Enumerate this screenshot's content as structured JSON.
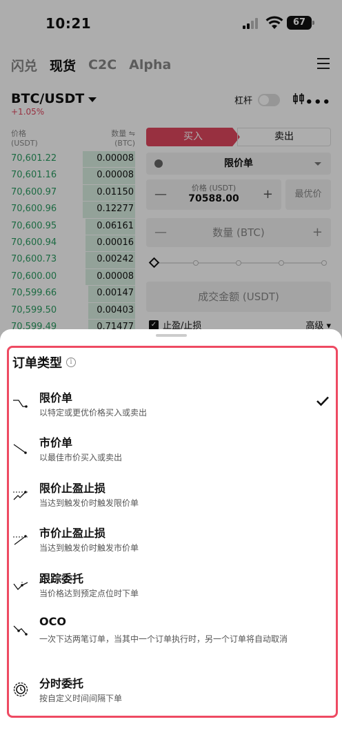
{
  "status": {
    "time": "10:21",
    "battery": "67"
  },
  "top_tabs": [
    {
      "label": "闪兑",
      "active": false
    },
    {
      "label": "现货",
      "active": true
    },
    {
      "label": "C2C",
      "active": false
    },
    {
      "label": "Alpha",
      "active": false
    }
  ],
  "pair": {
    "name": "BTC/USDT",
    "change": "+1.05%",
    "leverage_label": "杠杆"
  },
  "order_book": {
    "price_header": "价格",
    "price_unit": "(USDT)",
    "qty_header": "数量 ⇋",
    "qty_unit": "(BTC)",
    "rows": [
      {
        "price": "70,601.22",
        "qty": "0.00008",
        "depth": 0.42
      },
      {
        "price": "70,601.16",
        "qty": "0.00008",
        "depth": 0.42
      },
      {
        "price": "70,600.97",
        "qty": "0.01150",
        "depth": 0.42
      },
      {
        "price": "70,600.96",
        "qty": "0.12277",
        "depth": 0.42
      },
      {
        "price": "70,600.95",
        "qty": "0.06161",
        "depth": 0.4
      },
      {
        "price": "70,600.94",
        "qty": "0.00016",
        "depth": 0.4
      },
      {
        "price": "70,600.73",
        "qty": "0.00242",
        "depth": 0.4
      },
      {
        "price": "70,600.00",
        "qty": "0.00008",
        "depth": 0.4
      },
      {
        "price": "70,599.66",
        "qty": "0.00147",
        "depth": 0.38
      },
      {
        "price": "70,599.50",
        "qty": "0.00403",
        "depth": 0.38
      },
      {
        "price": "70,599.49",
        "qty": "0.71477",
        "depth": 0.38
      }
    ]
  },
  "trade_form": {
    "buy_label": "买入",
    "sell_label": "卖出",
    "order_type": "限价单",
    "price_label": "价格 (USDT)",
    "price_value": "70588.00",
    "best_price_label": "最优价",
    "qty_placeholder": "数量 (BTC)",
    "amount_placeholder": "成交金额 (USDT)",
    "tpsl_label": "止盈/止损",
    "advanced_label": "高级"
  },
  "sheet": {
    "title": "订单类型",
    "options": [
      {
        "name": "限价单",
        "desc": "以特定或更优价格买入或卖出",
        "icon": "limit-order-icon",
        "selected": true
      },
      {
        "name": "市价单",
        "desc": "以最佳市价买入或卖出",
        "icon": "market-order-icon",
        "selected": false
      },
      {
        "name": "限价止盈止损",
        "desc": "当达到触发价时触发限价单",
        "icon": "limit-tpsl-icon",
        "selected": false
      },
      {
        "name": "市价止盈止损",
        "desc": "当达到触发价时触发市价单",
        "icon": "market-tpsl-icon",
        "selected": false
      },
      {
        "name": "跟踪委托",
        "desc": "当价格达到预定点位时下单",
        "icon": "trailing-order-icon",
        "selected": false
      },
      {
        "name": "OCO",
        "desc": "一次下达两笔订单，当其中一个订单执行时，另一个订单将自动取消",
        "icon": "oco-icon",
        "selected": false
      },
      {
        "name": "分时委托",
        "desc": "按自定义时间间隔下单",
        "icon": "twap-clock-icon",
        "selected": false
      }
    ]
  },
  "colors": {
    "accent_red": "#e0475f",
    "highlight_border": "#ee4a62",
    "bid_green": "#2a9d62"
  }
}
